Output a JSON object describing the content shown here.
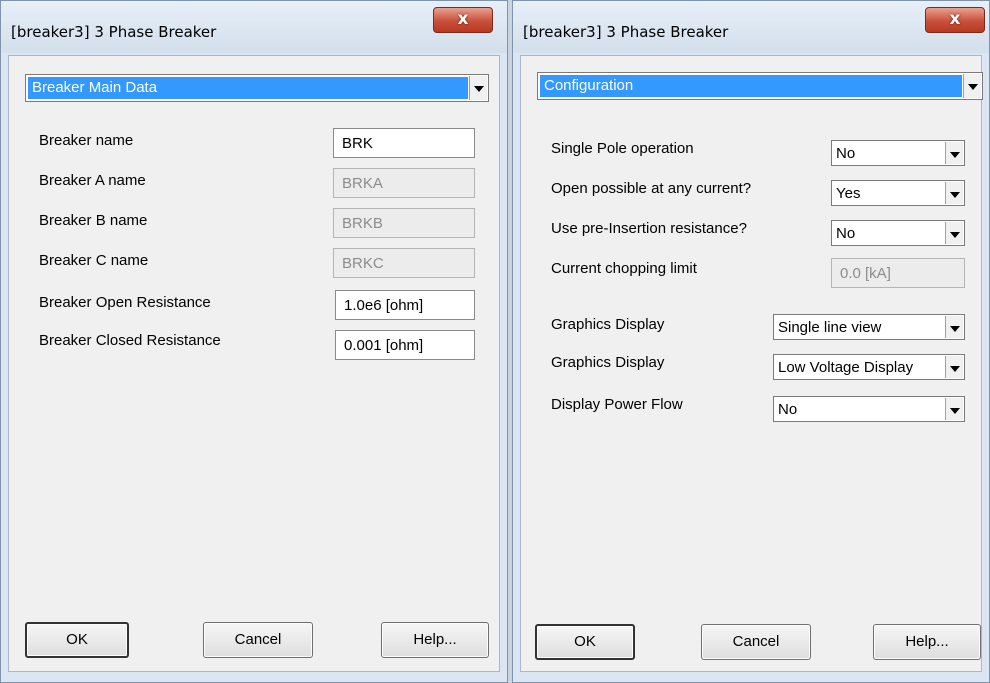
{
  "left_dialog": {
    "title": "[breaker3] 3 Phase Breaker",
    "close_label": "x",
    "section": "Breaker Main Data",
    "fields": [
      {
        "label": "Breaker name",
        "value": "BRK",
        "enabled": true
      },
      {
        "label": "Breaker A name",
        "value": "BRKA",
        "enabled": false
      },
      {
        "label": "Breaker B name",
        "value": "BRKB",
        "enabled": false
      },
      {
        "label": "Breaker C name",
        "value": "BRKC",
        "enabled": false
      },
      {
        "label": "Breaker Open Resistance",
        "value": "1.0e6 [ohm]",
        "enabled": true
      },
      {
        "label": "Breaker Closed  Resistance",
        "value": "0.001 [ohm]",
        "enabled": true
      }
    ],
    "buttons": {
      "ok": "OK",
      "cancel": "Cancel",
      "help": "Help..."
    }
  },
  "right_dialog": {
    "title": "[breaker3] 3 Phase Breaker",
    "close_label": "x",
    "section": "Configuration",
    "fields": [
      {
        "label": "Single Pole operation",
        "value": "No",
        "type": "select"
      },
      {
        "label": "Open possible at any current?",
        "value": "Yes",
        "type": "select"
      },
      {
        "label": "Use pre-Insertion resistance?",
        "value": "No",
        "type": "select"
      },
      {
        "label": "Current chopping limit",
        "value": "0.0 [kA]",
        "type": "text-disabled"
      },
      {
        "label": "Graphics Display",
        "value": "Single line view",
        "type": "select"
      },
      {
        "label": "Graphics Display",
        "value": "Low Voltage Display",
        "type": "select"
      },
      {
        "label": "Display Power Flow",
        "value": "No",
        "type": "select"
      }
    ],
    "buttons": {
      "ok": "OK",
      "cancel": "Cancel",
      "help": "Help..."
    }
  },
  "colors": {
    "section_highlight": "#3399ff",
    "close_button": "#c9503b",
    "dialog_face": "#f0f0f0",
    "frame": "#dbe6f2"
  }
}
